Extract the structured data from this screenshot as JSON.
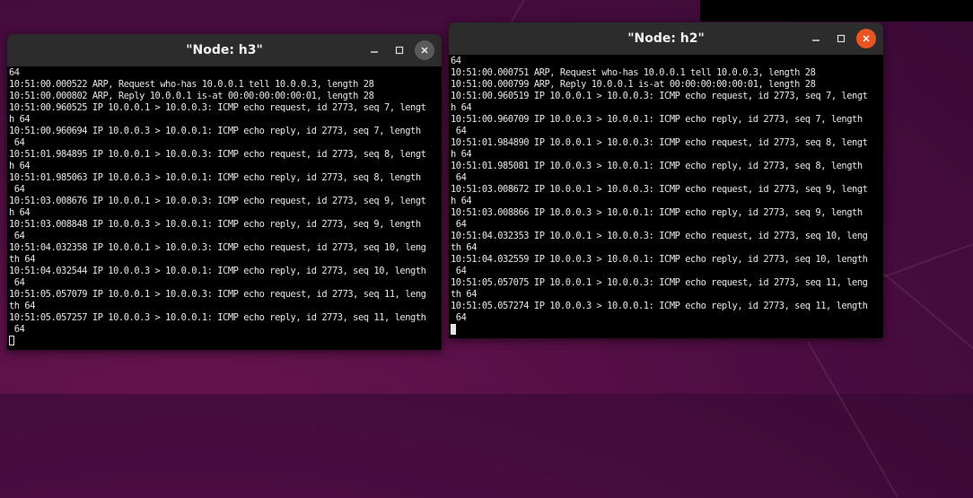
{
  "windows": {
    "h3": {
      "title": "\"Node: h3\"",
      "lines": [
        "64",
        "10:51:00.000522 ARP, Request who-has 10.0.0.1 tell 10.0.0.3, length 28",
        "10:51:00.000802 ARP, Reply 10.0.0.1 is-at 00:00:00:00:00:01, length 28",
        "10:51:00.960525 IP 10.0.0.1 > 10.0.0.3: ICMP echo request, id 2773, seq 7, lengt",
        "h 64",
        "10:51:00.960694 IP 10.0.0.3 > 10.0.0.1: ICMP echo reply, id 2773, seq 7, length",
        " 64",
        "10:51:01.984895 IP 10.0.0.1 > 10.0.0.3: ICMP echo request, id 2773, seq 8, lengt",
        "h 64",
        "10:51:01.985063 IP 10.0.0.3 > 10.0.0.1: ICMP echo reply, id 2773, seq 8, length",
        " 64",
        "10:51:03.008676 IP 10.0.0.1 > 10.0.0.3: ICMP echo request, id 2773, seq 9, lengt",
        "h 64",
        "10:51:03.008848 IP 10.0.0.3 > 10.0.0.1: ICMP echo reply, id 2773, seq 9, length",
        " 64",
        "10:51:04.032358 IP 10.0.0.1 > 10.0.0.3: ICMP echo request, id 2773, seq 10, leng",
        "th 64",
        "10:51:04.032544 IP 10.0.0.3 > 10.0.0.1: ICMP echo reply, id 2773, seq 10, length",
        " 64",
        "10:51:05.057079 IP 10.0.0.1 > 10.0.0.3: ICMP echo request, id 2773, seq 11, leng",
        "th 64",
        "10:51:05.057257 IP 10.0.0.3 > 10.0.0.1: ICMP echo reply, id 2773, seq 11, length",
        " 64"
      ]
    },
    "h2": {
      "title": "\"Node: h2\"",
      "lines": [
        "64",
        "10:51:00.000751 ARP, Request who-has 10.0.0.1 tell 10.0.0.3, length 28",
        "10:51:00.000799 ARP, Reply 10.0.0.1 is-at 00:00:00:00:00:01, length 28",
        "10:51:00.960519 IP 10.0.0.1 > 10.0.0.3: ICMP echo request, id 2773, seq 7, lengt",
        "h 64",
        "10:51:00.960709 IP 10.0.0.3 > 10.0.0.1: ICMP echo reply, id 2773, seq 7, length",
        " 64",
        "10:51:01.984890 IP 10.0.0.1 > 10.0.0.3: ICMP echo request, id 2773, seq 8, lengt",
        "h 64",
        "10:51:01.985081 IP 10.0.0.3 > 10.0.0.1: ICMP echo reply, id 2773, seq 8, length",
        " 64",
        "10:51:03.008672 IP 10.0.0.1 > 10.0.0.3: ICMP echo request, id 2773, seq 9, lengt",
        "h 64",
        "10:51:03.008866 IP 10.0.0.3 > 10.0.0.1: ICMP echo reply, id 2773, seq 9, length",
        " 64",
        "10:51:04.032353 IP 10.0.0.1 > 10.0.0.3: ICMP echo request, id 2773, seq 10, leng",
        "th 64",
        "10:51:04.032559 IP 10.0.0.3 > 10.0.0.1: ICMP echo reply, id 2773, seq 10, length",
        " 64",
        "10:51:05.057075 IP 10.0.0.1 > 10.0.0.3: ICMP echo request, id 2773, seq 11, leng",
        "th 64",
        "10:51:05.057274 IP 10.0.0.3 > 10.0.0.1: ICMP echo reply, id 2773, seq 11, length",
        " 64"
      ]
    }
  },
  "icons": {
    "minimize": "minimize-icon",
    "maximize": "maximize-icon",
    "close": "close-icon"
  },
  "colors": {
    "desktop_bg": "#4a0c40",
    "titlebar": "#2c2c2c",
    "terminal_bg": "#000000",
    "terminal_fg": "#e6e6e6",
    "close_active": "#e95420"
  }
}
